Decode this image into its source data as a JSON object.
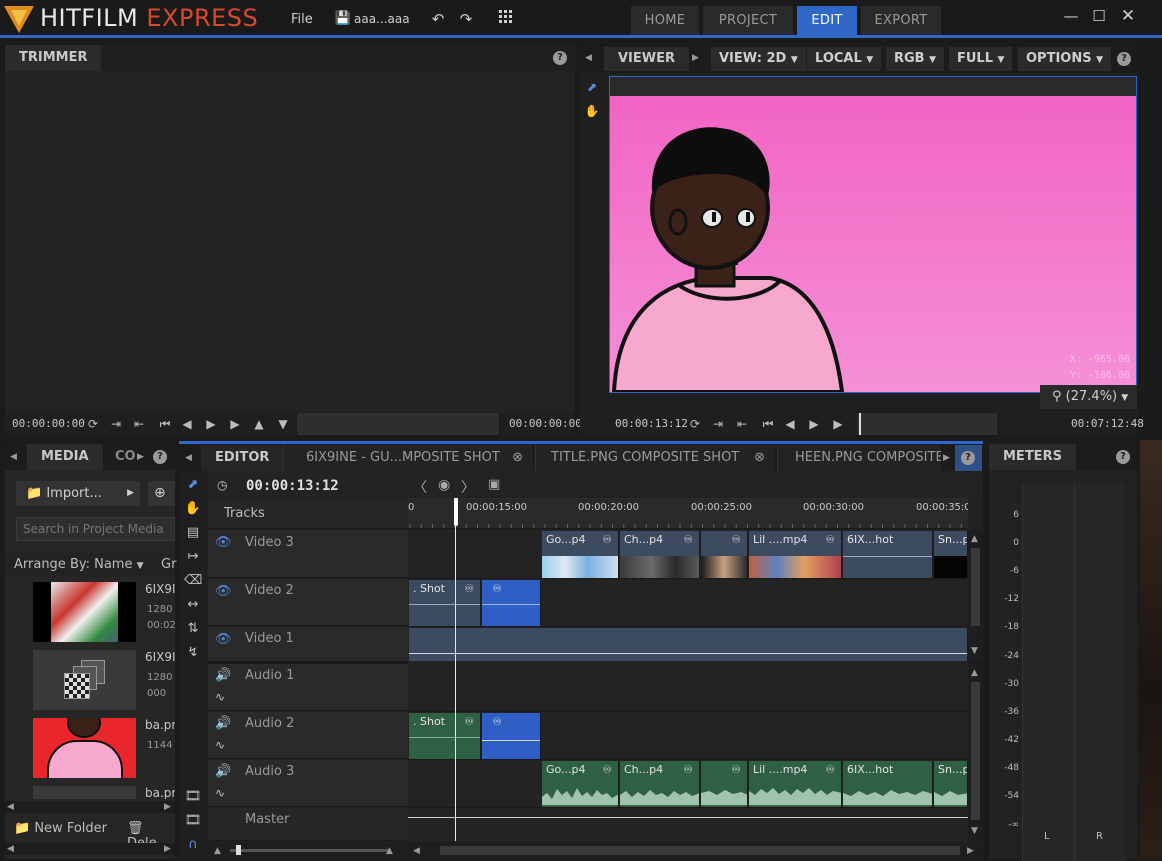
{
  "app": {
    "logo_hit": "HITFILM",
    "logo_express": "EXPRESS",
    "brand_color": "#d6492c",
    "accent_color": "#2f67c7"
  },
  "topbar": {
    "file_menu": "File",
    "project_name": "aaa...aaa",
    "save_icon": "save-icon",
    "undo_icon": "undo-icon",
    "redo_icon": "redo-icon",
    "grid_icon": "grid-icon",
    "nav_tabs": [
      "HOME",
      "PROJECT",
      "EDIT",
      "EXPORT"
    ],
    "active_tab": "EDIT"
  },
  "trimmer": {
    "title": "TRIMMER",
    "timecode_in": "00:00:00:00",
    "timecode_out": "00:00:00:00"
  },
  "viewer": {
    "title": "VIEWER",
    "view_mode": "VIEW: 2D",
    "space": "LOCAL",
    "channel": "RGB",
    "quality": "FULL",
    "options": "OPTIONS",
    "coords_x": "X: -965.00",
    "coords_y": "Y: -186.00",
    "zoom": "(27.4%)",
    "timecode_current": "00:00:13:12",
    "timecode_duration": "00:07:12:48"
  },
  "media": {
    "tab_media": "MEDIA",
    "tab_other": "CO",
    "import_label": "Import...",
    "search_placeholder": "Search in Project Media",
    "arrange_label": "Arrange By: Name",
    "group_label": "Gr",
    "items": [
      {
        "name": "6IX9I",
        "line1": "1280",
        "line2": "00:02"
      },
      {
        "name": "6IX9I",
        "line1": "1280",
        "line2": "000"
      },
      {
        "name": "ba.pr",
        "line1": "1144",
        "line2": ""
      },
      {
        "name": "ba.pr",
        "line1": "",
        "line2": ""
      }
    ],
    "new_folder": "New Folder",
    "delete": "Dele"
  },
  "editor": {
    "tabs": [
      "EDITOR",
      "6IX9INE - GU...MPOSITE SHOT",
      "TITLE.PNG COMPOSITE SHOT",
      "HEEN.PNG COMPOSITE"
    ],
    "timecode": "00:00:13:12",
    "tracks_label": "Tracks",
    "ruler_labels": [
      "0",
      "00:00:15:00",
      "00:00:20:00",
      "00:00:25:00",
      "00:00:30:00",
      "00:00:35:0"
    ],
    "tracks": [
      {
        "name": "Video 3",
        "type": "video"
      },
      {
        "name": "Video 2",
        "type": "video"
      },
      {
        "name": "Video 1",
        "type": "video"
      },
      {
        "name": "Audio 1",
        "type": "audio"
      },
      {
        "name": "Audio 2",
        "type": "audio"
      },
      {
        "name": "Audio 3",
        "type": "audio"
      },
      {
        "name": "Master",
        "type": "master"
      }
    ],
    "video3_clips": [
      "Go...p4",
      "Ch...p4",
      "",
      "Lil ....mp4",
      "6IX...hot",
      "Sn...p"
    ],
    "video2_clips": [
      ". Shot",
      ""
    ],
    "audio2_clips": [
      ". Shot",
      ""
    ],
    "audio3_clips": [
      "Go...p4",
      "Ch...p4",
      "",
      "Lil ....mp4",
      "6IX...hot",
      "Sn...p"
    ]
  },
  "meters": {
    "title": "METERS",
    "scale": [
      "6",
      "0",
      "-6",
      "-12",
      "-18",
      "-24",
      "-30",
      "-36",
      "-42",
      "-48",
      "-54",
      "-∞"
    ],
    "left_label": "L",
    "right_label": "R"
  }
}
